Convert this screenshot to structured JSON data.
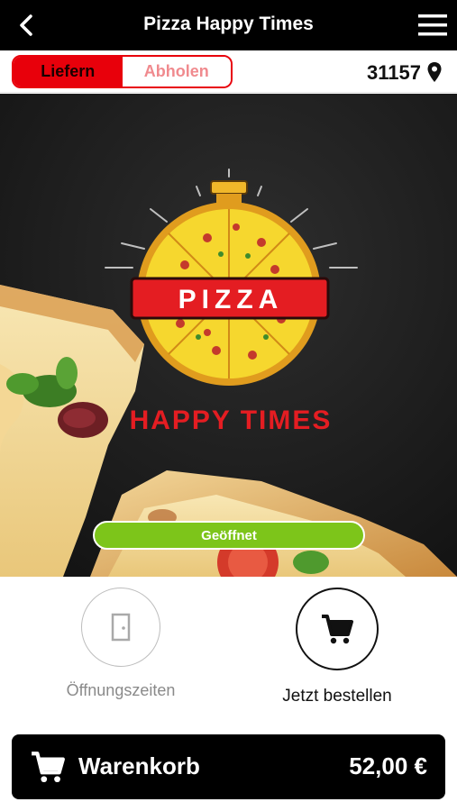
{
  "header": {
    "title": "Pizza Happy Times"
  },
  "mode_toggle": {
    "deliver_label": "Liefern",
    "pickup_label": "Abholen",
    "selected": "Liefern"
  },
  "location": {
    "zip": "31157"
  },
  "hero": {
    "logo_word": "PIZZA",
    "logo_tagline": "HAPPY TIMES",
    "status_label": "Geöffnet"
  },
  "actions": {
    "hours_label": "Öffnungszeiten",
    "order_label": "Jetzt bestellen"
  },
  "cart": {
    "label": "Warenkorb",
    "total": "52,00 €"
  },
  "colors": {
    "brand_red": "#e8000b",
    "open_green": "#7dc51a",
    "bar_black": "#000000"
  }
}
